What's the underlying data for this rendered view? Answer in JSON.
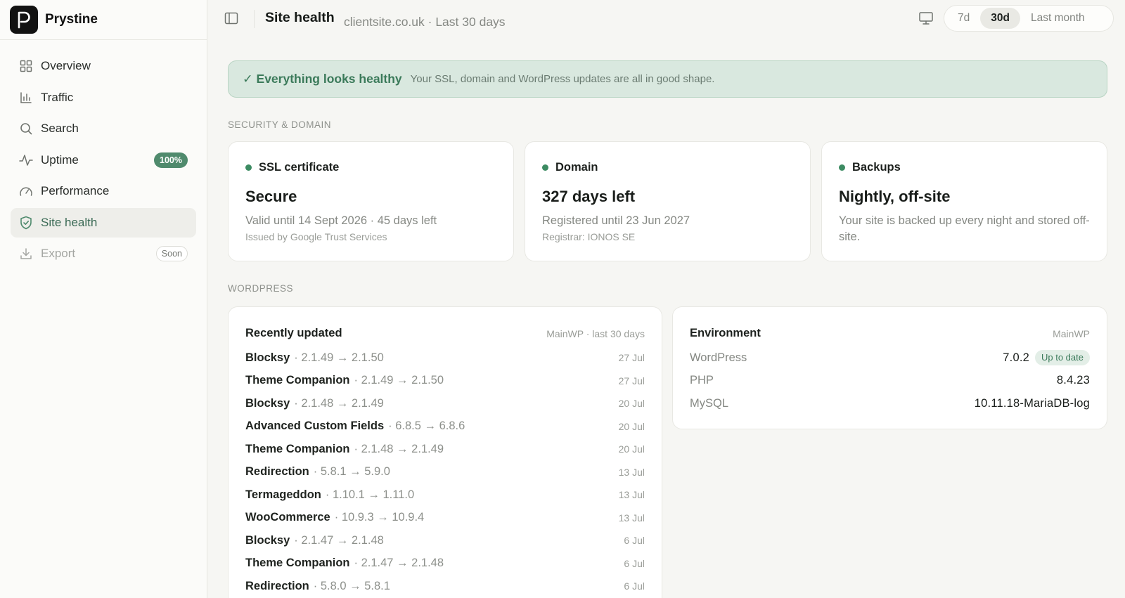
{
  "brand": {
    "name": "Prystine",
    "logo_letter": "P"
  },
  "sidebar": {
    "items": [
      {
        "label": "Overview",
        "icon": "grid-icon"
      },
      {
        "label": "Traffic",
        "icon": "bar-chart-icon"
      },
      {
        "label": "Search",
        "icon": "search-icon"
      },
      {
        "label": "Uptime",
        "icon": "pulse-icon",
        "badge": "100%"
      },
      {
        "label": "Performance",
        "icon": "gauge-icon"
      },
      {
        "label": "Site health",
        "icon": "shield-check-icon",
        "active": true
      },
      {
        "label": "Export",
        "icon": "download-icon",
        "tag": "Soon",
        "disabled": true
      }
    ]
  },
  "header": {
    "title": "Site health",
    "subtitle": "clientsite.co.uk · Last 30 days",
    "range_options": [
      "7d",
      "30d",
      "Last month"
    ],
    "range_selected": "30d"
  },
  "alert": {
    "title": "✓ Everything looks healthy",
    "text": "Your SSL, domain and WordPress updates are all in good shape."
  },
  "sections": {
    "security": "SECURITY & DOMAIN",
    "wordpress": "WORDPRESS"
  },
  "cards": {
    "ssl": {
      "title": "SSL certificate",
      "value": "Secure",
      "desc": "Valid until 14 Sept 2026 · 45 days left",
      "small": "Issued by Google Trust Services"
    },
    "domain": {
      "title": "Domain",
      "value": "327 days left",
      "desc": "Registered until 23 Jun 2027",
      "small": "Registrar: IONOS SE"
    },
    "backups": {
      "title": "Backups",
      "value": "Nightly, off-site",
      "desc": "Your site is backed up every night and stored off-site."
    }
  },
  "updates": {
    "title": "Recently updated",
    "meta": "MainWP · last 30 days",
    "rows": [
      {
        "name": "Blocksy",
        "ver": "· 2.1.49 → 2.1.50",
        "date": "27 Jul"
      },
      {
        "name": "Theme Companion",
        "ver": "· 2.1.49 → 2.1.50",
        "date": "27 Jul"
      },
      {
        "name": "Blocksy",
        "ver": "· 2.1.48 → 2.1.49",
        "date": "20 Jul"
      },
      {
        "name": "Advanced Custom Fields",
        "ver": "· 6.8.5 → 6.8.6",
        "date": "20 Jul"
      },
      {
        "name": "Theme Companion",
        "ver": "· 2.1.48 → 2.1.49",
        "date": "20 Jul"
      },
      {
        "name": "Redirection",
        "ver": "· 5.8.1 → 5.9.0",
        "date": "13 Jul"
      },
      {
        "name": "Termageddon",
        "ver": "· 1.10.1 → 1.11.0",
        "date": "13 Jul"
      },
      {
        "name": "WooCommerce",
        "ver": "· 10.9.3 → 10.9.4",
        "date": "13 Jul"
      },
      {
        "name": "Blocksy",
        "ver": "· 2.1.47 → 2.1.48",
        "date": "6 Jul"
      },
      {
        "name": "Theme Companion",
        "ver": "· 2.1.47 → 2.1.48",
        "date": "6 Jul"
      },
      {
        "name": "Redirection",
        "ver": "· 5.8.0 → 5.8.1",
        "date": "6 Jul"
      }
    ]
  },
  "environment": {
    "title": "Environment",
    "meta": "MainWP",
    "rows": [
      {
        "label": "WordPress",
        "value": "7.0.2",
        "badge": "Up to date"
      },
      {
        "label": "PHP",
        "value": "8.4.23"
      },
      {
        "label": "MySQL",
        "value": "10.11.18-MariaDB-log"
      }
    ]
  },
  "colors": {
    "accent": "#4f8a6d",
    "status_ok": "#3c8b62",
    "alert_bg": "#d9e8df"
  }
}
